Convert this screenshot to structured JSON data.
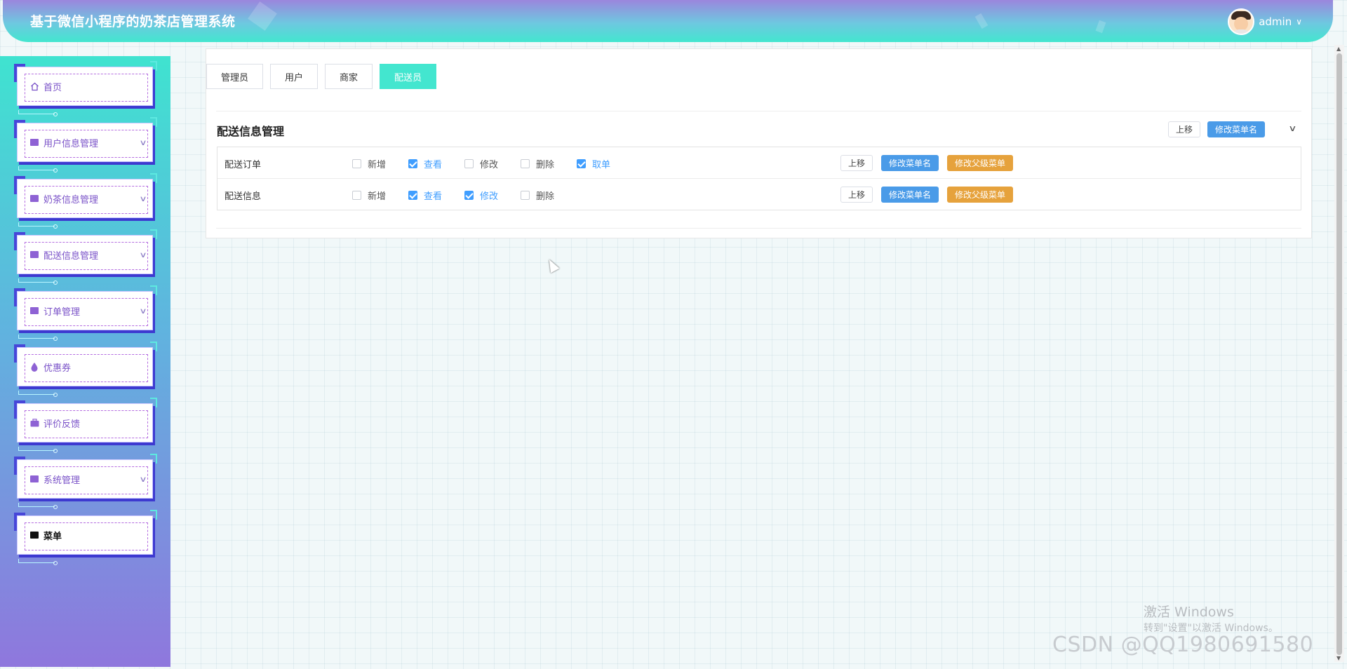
{
  "app": {
    "title": "基于微信小程序的奶茶店管理系统",
    "user": "admin",
    "colors": {
      "accent": "#43e6cf",
      "primary": "#4a9be8",
      "warning": "#e6a23c",
      "menu_text": "#7a52c8"
    }
  },
  "sidebar": {
    "items": [
      {
        "label": "首页",
        "icon": "home-icon",
        "has_arrow": false,
        "active": false
      },
      {
        "label": "用户信息管理",
        "icon": "folder-icon",
        "has_arrow": true,
        "active": false
      },
      {
        "label": "奶茶信息管理",
        "icon": "folder-icon",
        "has_arrow": true,
        "active": false
      },
      {
        "label": "配送信息管理",
        "icon": "folder-icon",
        "has_arrow": true,
        "active": false
      },
      {
        "label": "订单管理",
        "icon": "order-icon",
        "has_arrow": true,
        "active": false
      },
      {
        "label": "优惠券",
        "icon": "drop-icon",
        "has_arrow": false,
        "active": false
      },
      {
        "label": "评价反馈",
        "icon": "briefcase-icon",
        "has_arrow": false,
        "active": false
      },
      {
        "label": "系统管理",
        "icon": "book-icon",
        "has_arrow": true,
        "active": false
      },
      {
        "label": "菜单",
        "icon": "grid-icon",
        "has_arrow": false,
        "active": true
      }
    ]
  },
  "tabs": [
    {
      "label": "管理员",
      "active": false
    },
    {
      "label": "用户",
      "active": false
    },
    {
      "label": "商家",
      "active": false
    },
    {
      "label": "配送员",
      "active": true
    }
  ],
  "section": {
    "title": "配送信息管理",
    "move_up": "上移",
    "rename": "修改菜单名"
  },
  "rows": [
    {
      "name": "配送订单",
      "perms": [
        {
          "label": "新增",
          "checked": false
        },
        {
          "label": "查看",
          "checked": true
        },
        {
          "label": "修改",
          "checked": false
        },
        {
          "label": "删除",
          "checked": false
        },
        {
          "label": "取单",
          "checked": true
        }
      ],
      "actions": {
        "move_up": "上移",
        "rename": "修改菜单名",
        "change_parent": "修改父级菜单"
      }
    },
    {
      "name": "配送信息",
      "perms": [
        {
          "label": "新增",
          "checked": false
        },
        {
          "label": "查看",
          "checked": true
        },
        {
          "label": "修改",
          "checked": true
        },
        {
          "label": "删除",
          "checked": false
        }
      ],
      "actions": {
        "move_up": "上移",
        "rename": "修改菜单名",
        "change_parent": "修改父级菜单"
      }
    }
  ],
  "watermark": {
    "activate_title": "激活 Windows",
    "activate_hint": "转到\"设置\"以激活 Windows。",
    "csdn": "CSDN @QQ1980691580"
  }
}
